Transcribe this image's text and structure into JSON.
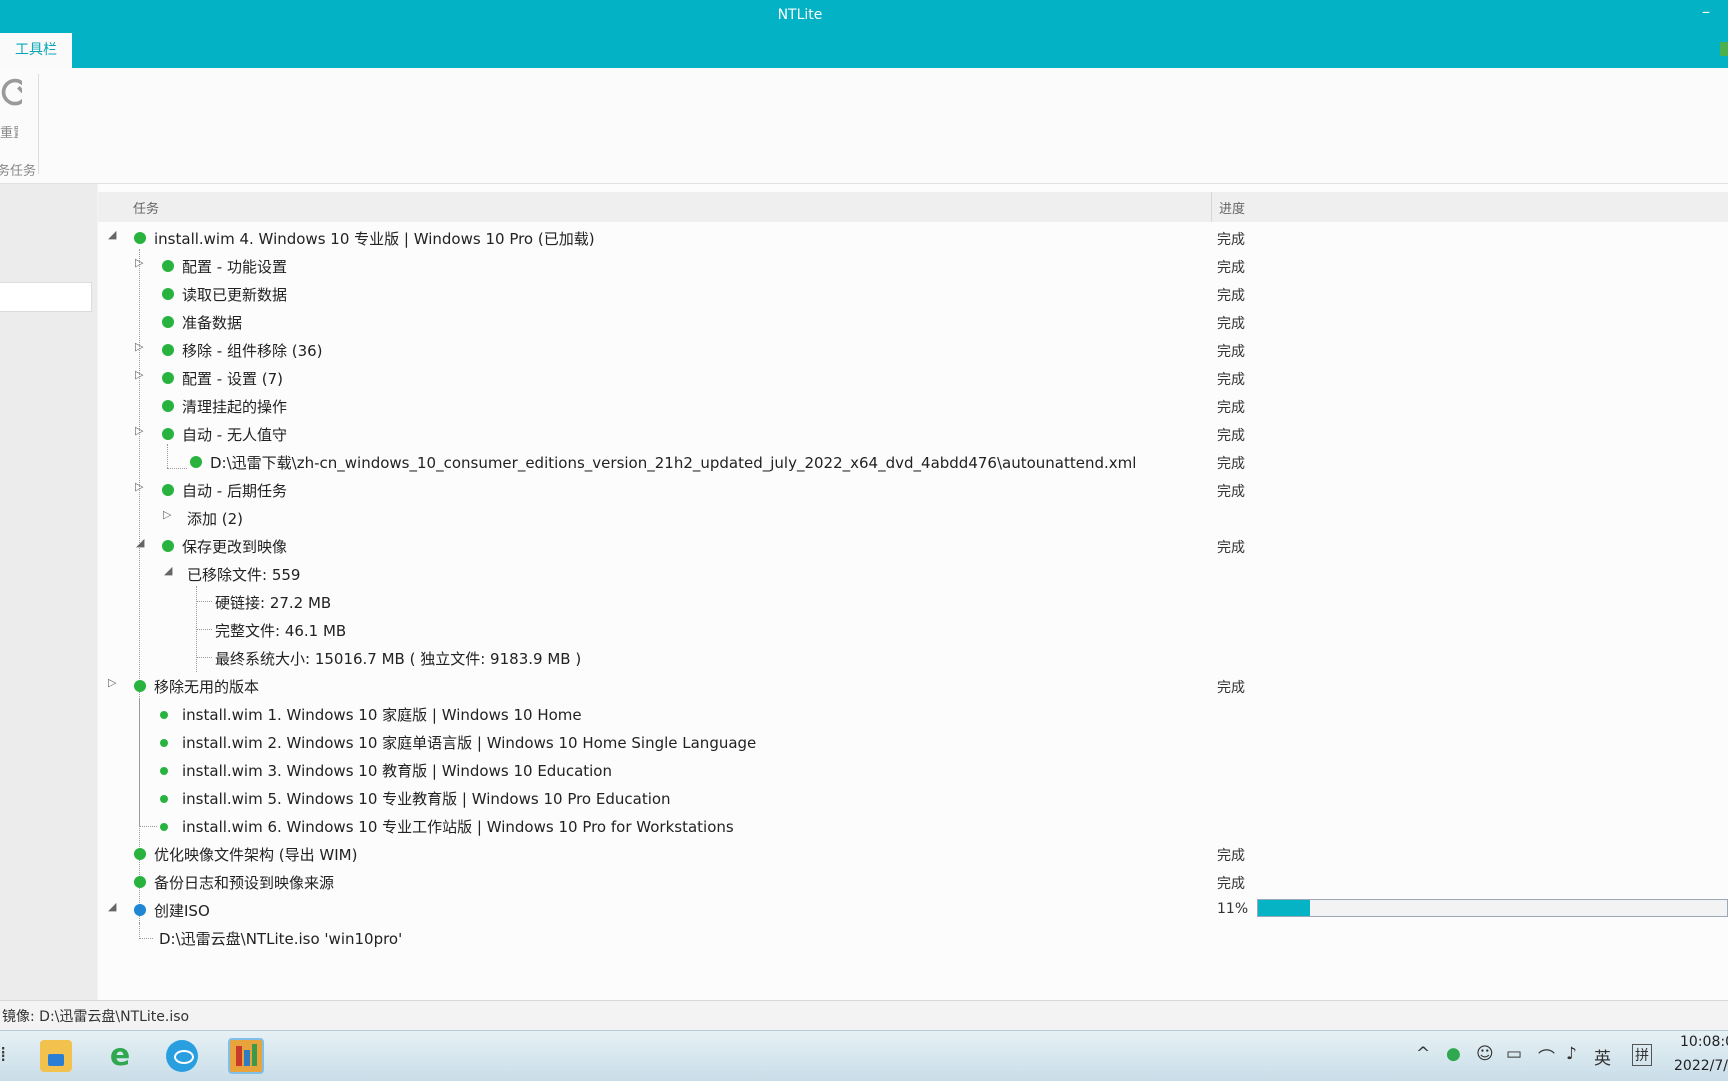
{
  "window": {
    "title": "NTLite",
    "minimize_glyph": "–"
  },
  "ribbon": {
    "tab_label": "工具栏",
    "reset_label": "重置",
    "group_label": "务任务"
  },
  "tree": {
    "col_task": "任务",
    "col_progress": "进度",
    "rows": [
      {
        "text": "install.wim 4. Windows 10 专业版 | Windows 10 Pro (已加载)",
        "status": "完成"
      },
      {
        "text": "配置 - 功能设置",
        "status": "完成"
      },
      {
        "text": "读取已更新数据",
        "status": "完成"
      },
      {
        "text": "准备数据",
        "status": "完成"
      },
      {
        "text": "移除 - 组件移除 (36)",
        "status": "完成"
      },
      {
        "text": "配置 - 设置 (7)",
        "status": "完成"
      },
      {
        "text": "清理挂起的操作",
        "status": "完成"
      },
      {
        "text": "自动 - 无人值守",
        "status": "完成"
      },
      {
        "text": "D:\\迅雷下载\\zh-cn_windows_10_consumer_editions_version_21h2_updated_july_2022_x64_dvd_4abdd476\\autounattend.xml",
        "status": "完成"
      },
      {
        "text": "自动 - 后期任务",
        "status": "完成"
      },
      {
        "text": "添加 (2)",
        "status": ""
      },
      {
        "text": "保存更改到映像",
        "status": "完成"
      },
      {
        "text": "已移除文件: 559",
        "status": ""
      },
      {
        "text": "硬链接: 27.2 MB",
        "status": ""
      },
      {
        "text": "完整文件: 46.1 MB",
        "status": ""
      },
      {
        "text": "最终系统大小: 15016.7 MB ( 独立文件: 9183.9 MB )",
        "status": ""
      },
      {
        "text": "移除无用的版本",
        "status": "完成"
      },
      {
        "text": "install.wim 1. Windows 10 家庭版 | Windows 10 Home",
        "status": ""
      },
      {
        "text": "install.wim 2. Windows 10 家庭单语言版 | Windows 10 Home Single Language",
        "status": ""
      },
      {
        "text": "install.wim 3. Windows 10 教育版 | Windows 10 Education",
        "status": ""
      },
      {
        "text": "install.wim 5. Windows 10 专业教育版 | Windows 10 Pro Education",
        "status": ""
      },
      {
        "text": "install.wim 6. Windows 10 专业工作站版 | Windows 10 Pro for Workstations",
        "status": ""
      },
      {
        "text": "优化映像文件架构 (导出 WIM)",
        "status": "完成"
      },
      {
        "text": "备份日志和预设到映像来源",
        "status": "完成"
      },
      {
        "text": "创建ISO",
        "status": "11%"
      },
      {
        "text": "D:\\迅雷云盘\\NTLite.iso 'win10pro'",
        "status": ""
      }
    ],
    "iso_progress": 0.11
  },
  "statusbar": {
    "text": "镜像: D:\\迅雷云盘\\NTLite.iso"
  },
  "taskbar": {
    "start_glyph": "⁞",
    "tray_ime_lang": "英",
    "tray_ime_mode": "拼",
    "clock_time": "10:08:0",
    "clock_date": "2022/7/"
  },
  "icons": {
    "reset": "refresh-icon",
    "file_explorer": "folder-icon",
    "browser": "ie-icon",
    "app": "chat-app-icon",
    "ntlite": "ntlite-icon"
  },
  "colors": {
    "accent": "#03b2c4",
    "done_dot": "#28b33f",
    "active_dot": "#1f86d3"
  }
}
